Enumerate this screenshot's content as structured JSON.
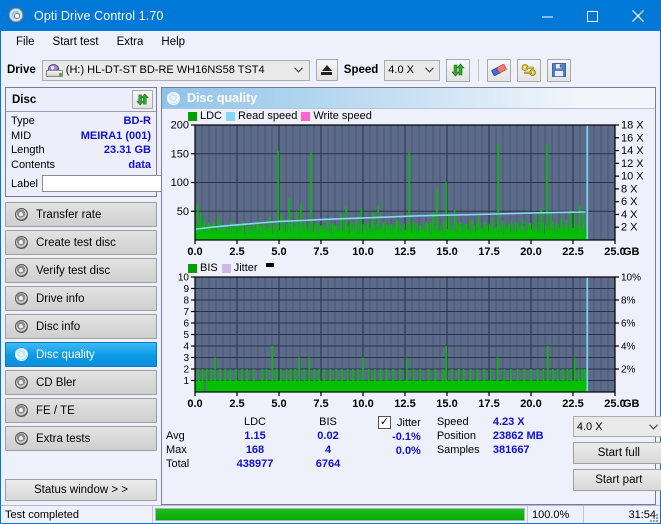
{
  "window": {
    "title": "Opti Drive Control 1.70",
    "icon": "cd-disc-icon",
    "minimize": "minimize-icon",
    "maximize": "maximize-icon",
    "close": "close-icon"
  },
  "menu": [
    {
      "label": "File"
    },
    {
      "label": "Start test"
    },
    {
      "label": "Extra"
    },
    {
      "label": "Help"
    }
  ],
  "toolbar": {
    "drive_label": "Drive",
    "drive_value": "(H:)   HL-DT-ST BD-RE  WH16NS58 TST4",
    "eject_icon": "eject-icon",
    "speed_label": "Speed",
    "speed_value": "4.0 X",
    "refresh_icon": "refresh-icon",
    "eraser_icon": "eraser-icon",
    "keys_icon": "keys-icon",
    "save_icon": "save-disk-icon"
  },
  "disc_panel": {
    "title": "Disc",
    "refresh_icon": "refresh-icon",
    "rows": [
      {
        "key": "Type",
        "value": "BD-R"
      },
      {
        "key": "MID",
        "value": "MEIRA1 (001)"
      },
      {
        "key": "Length",
        "value": "23.31 GB"
      },
      {
        "key": "Contents",
        "value": "data"
      }
    ],
    "label_key": "Label",
    "label_value": "",
    "label_placeholder": "",
    "disc_button_icon": "gold-disc-icon"
  },
  "sidebar": {
    "items": [
      {
        "label": "Transfer rate",
        "icon": "disc-icon",
        "active": false
      },
      {
        "label": "Create test disc",
        "icon": "disc-icon",
        "active": false
      },
      {
        "label": "Verify test disc",
        "icon": "disc-icon",
        "active": false
      },
      {
        "label": "Drive info",
        "icon": "disc-icon",
        "active": false
      },
      {
        "label": "Disc info",
        "icon": "disc-icon",
        "active": false
      },
      {
        "label": "Disc quality",
        "icon": "disc-icon",
        "active": true
      },
      {
        "label": "CD Bler",
        "icon": "disc-icon",
        "active": false
      },
      {
        "label": "FE / TE",
        "icon": "disc-icon",
        "active": false
      },
      {
        "label": "Extra tests",
        "icon": "disc-icon",
        "active": false
      }
    ],
    "status_window_button": "Status window > >"
  },
  "main": {
    "title": "Disc quality",
    "title_icon": "disc-icon"
  },
  "stats": {
    "col_headers": [
      "LDC",
      "BIS"
    ],
    "rows": [
      {
        "name": "Avg",
        "ldc": "1.15",
        "bis": "0.02",
        "jitter": "-0.1%"
      },
      {
        "name": "Max",
        "ldc": "168",
        "bis": "4",
        "jitter": "0.0%"
      },
      {
        "name": "Total",
        "ldc": "438977",
        "bis": "6764",
        "jitter": ""
      }
    ],
    "jitter_label": "Jitter",
    "jitter_checked": true,
    "speed_label": "Speed",
    "speed_value": "4.23 X",
    "position_label": "Position",
    "position_value": "23862 MB",
    "samples_label": "Samples",
    "samples_value": "381667",
    "speed_select_value": "4.0 X",
    "start_full_button": "Start full",
    "start_part_button": "Start part"
  },
  "statusbar": {
    "message": "Test completed",
    "progress_percent": 100.0,
    "progress_text": "100.0%",
    "elapsed": "31:54"
  },
  "chart_data": [
    {
      "id": "ldc-chart",
      "type": "area",
      "title": "",
      "xlabel": "GB",
      "ylabel": "LDC",
      "xlim": [
        0,
        25.0
      ],
      "ylim": [
        0,
        200
      ],
      "xticks": [
        "0.0",
        "2.5",
        "5.0",
        "7.5",
        "10.0",
        "12.5",
        "15.0",
        "17.5",
        "20.0",
        "22.5",
        "25.0"
      ],
      "yticks": [
        "50",
        "100",
        "150",
        "200"
      ],
      "y2label": "X",
      "y2lim": [
        0,
        18
      ],
      "y2ticks": [
        "2 X",
        "4 X",
        "6 X",
        "8 X",
        "10 X",
        "12 X",
        "14 X",
        "16 X",
        "18 X"
      ],
      "grid": true,
      "legend": [
        {
          "name": "LDC",
          "color": "#00a000"
        },
        {
          "name": "Read speed",
          "color": "#86d6f5"
        },
        {
          "name": "Write speed",
          "color": "#ff66cc"
        }
      ],
      "colors": {
        "plot_bg": "#5d6b8a",
        "grid": "#28324a",
        "axis": "#000000"
      },
      "series": [
        {
          "name": "LDC",
          "color": "#00c000",
          "x_end": 23.31,
          "baseline": [
            10,
            12,
            11,
            14,
            10,
            9,
            12,
            11,
            10,
            13,
            11,
            10,
            12,
            9,
            11,
            10,
            12,
            11,
            10,
            12,
            11,
            9,
            10,
            12,
            11,
            10,
            13,
            11,
            10,
            12,
            11,
            10,
            9,
            12,
            11,
            10,
            12,
            11,
            13,
            10,
            11,
            12,
            10,
            11,
            9,
            12,
            11,
            10,
            12,
            11,
            10,
            11,
            12,
            10,
            11,
            13,
            11,
            10,
            12,
            11,
            10,
            12,
            11,
            10,
            13,
            11,
            12,
            10,
            11,
            12,
            10,
            11,
            12,
            11,
            10,
            12,
            11,
            13,
            10,
            11,
            12,
            10,
            11,
            12,
            11,
            10,
            12,
            11,
            10,
            13,
            11,
            10,
            12,
            11,
            10,
            12,
            11,
            10,
            11,
            12
          ],
          "spikes": [
            {
              "x": 0.15,
              "y": 62
            },
            {
              "x": 0.35,
              "y": 48
            },
            {
              "x": 0.55,
              "y": 36
            },
            {
              "x": 0.8,
              "y": 30
            },
            {
              "x": 1.1,
              "y": 28
            },
            {
              "x": 1.45,
              "y": 42
            },
            {
              "x": 1.75,
              "y": 25
            },
            {
              "x": 2.1,
              "y": 22
            },
            {
              "x": 2.4,
              "y": 30
            },
            {
              "x": 2.85,
              "y": 26
            },
            {
              "x": 3.3,
              "y": 24
            },
            {
              "x": 3.7,
              "y": 33
            },
            {
              "x": 4.1,
              "y": 27
            },
            {
              "x": 4.45,
              "y": 40
            },
            {
              "x": 4.95,
              "y": 155
            },
            {
              "x": 5.15,
              "y": 45
            },
            {
              "x": 5.35,
              "y": 29
            },
            {
              "x": 5.6,
              "y": 72
            },
            {
              "x": 5.8,
              "y": 35
            },
            {
              "x": 6.05,
              "y": 50
            },
            {
              "x": 6.3,
              "y": 62
            },
            {
              "x": 6.6,
              "y": 30
            },
            {
              "x": 6.9,
              "y": 152
            },
            {
              "x": 7.15,
              "y": 28
            },
            {
              "x": 7.5,
              "y": 25
            },
            {
              "x": 7.9,
              "y": 33
            },
            {
              "x": 8.3,
              "y": 27
            },
            {
              "x": 8.7,
              "y": 46
            },
            {
              "x": 9.0,
              "y": 58
            },
            {
              "x": 9.3,
              "y": 31
            },
            {
              "x": 9.6,
              "y": 40
            },
            {
              "x": 9.9,
              "y": 55
            },
            {
              "x": 10.3,
              "y": 33
            },
            {
              "x": 10.6,
              "y": 48
            },
            {
              "x": 10.9,
              "y": 60
            },
            {
              "x": 11.2,
              "y": 30
            },
            {
              "x": 11.6,
              "y": 27
            },
            {
              "x": 12.0,
              "y": 35
            },
            {
              "x": 12.35,
              "y": 29
            },
            {
              "x": 12.75,
              "y": 152
            },
            {
              "x": 13.0,
              "y": 32
            },
            {
              "x": 13.4,
              "y": 26
            },
            {
              "x": 13.8,
              "y": 30
            },
            {
              "x": 14.15,
              "y": 48
            },
            {
              "x": 14.4,
              "y": 89
            },
            {
              "x": 14.95,
              "y": 100
            },
            {
              "x": 15.1,
              "y": 44
            },
            {
              "x": 15.45,
              "y": 52
            },
            {
              "x": 15.8,
              "y": 32
            },
            {
              "x": 16.1,
              "y": 28
            },
            {
              "x": 16.5,
              "y": 36
            },
            {
              "x": 16.9,
              "y": 45
            },
            {
              "x": 17.3,
              "y": 30
            },
            {
              "x": 17.7,
              "y": 40
            },
            {
              "x": 18.05,
              "y": 168
            },
            {
              "x": 18.3,
              "y": 34
            },
            {
              "x": 18.7,
              "y": 28
            },
            {
              "x": 19.1,
              "y": 32
            },
            {
              "x": 19.5,
              "y": 38
            },
            {
              "x": 19.9,
              "y": 30
            },
            {
              "x": 20.3,
              "y": 44
            },
            {
              "x": 20.6,
              "y": 55
            },
            {
              "x": 20.95,
              "y": 166
            },
            {
              "x": 21.2,
              "y": 47
            },
            {
              "x": 21.5,
              "y": 30
            },
            {
              "x": 21.8,
              "y": 40
            },
            {
              "x": 22.1,
              "y": 35
            },
            {
              "x": 22.35,
              "y": 52
            },
            {
              "x": 22.6,
              "y": 43
            },
            {
              "x": 22.9,
              "y": 60
            },
            {
              "x": 23.1,
              "y": 48
            }
          ]
        },
        {
          "name": "Read speed",
          "color": "#86d6f5",
          "points": [
            {
              "x": 0.05,
              "y": 1.7
            },
            {
              "x": 1.0,
              "y": 2.0
            },
            {
              "x": 2.2,
              "y": 2.3
            },
            {
              "x": 3.6,
              "y": 2.6
            },
            {
              "x": 5.0,
              "y": 2.9
            },
            {
              "x": 6.4,
              "y": 3.05
            },
            {
              "x": 7.5,
              "y": 3.2
            },
            {
              "x": 9.0,
              "y": 3.35
            },
            {
              "x": 10.5,
              "y": 3.5
            },
            {
              "x": 12.0,
              "y": 3.65
            },
            {
              "x": 13.3,
              "y": 3.78
            },
            {
              "x": 14.8,
              "y": 3.88
            },
            {
              "x": 16.3,
              "y": 3.95
            },
            {
              "x": 17.6,
              "y": 4.05
            },
            {
              "x": 19.0,
              "y": 4.15
            },
            {
              "x": 20.4,
              "y": 4.25
            },
            {
              "x": 21.8,
              "y": 4.32
            },
            {
              "x": 23.25,
              "y": 4.4
            }
          ]
        },
        {
          "name": "End marker",
          "color": "#7fd8f8",
          "vertical_line_x": 23.35
        }
      ]
    },
    {
      "id": "bis-chart",
      "type": "area",
      "title": "",
      "xlabel": "GB",
      "ylabel": "BIS",
      "xlim": [
        0,
        25.0
      ],
      "ylim": [
        0,
        10
      ],
      "xticks": [
        "0.0",
        "2.5",
        "5.0",
        "7.5",
        "10.0",
        "12.5",
        "15.0",
        "17.5",
        "20.0",
        "22.5",
        "25.0"
      ],
      "yticks": [
        "1",
        "2",
        "3",
        "4",
        "5",
        "6",
        "7",
        "8",
        "9",
        "10"
      ],
      "y2label": "%",
      "y2lim": [
        0,
        10
      ],
      "y2ticks": [
        "2%",
        "4%",
        "6%",
        "8%",
        "10%"
      ],
      "grid": true,
      "legend": [
        {
          "name": "BIS",
          "color": "#00a000"
        },
        {
          "name": "Jitter",
          "color": "#d0b8e8"
        }
      ],
      "colors": {
        "plot_bg": "#5d6b8a",
        "grid": "#28324a",
        "axis": "#000000"
      },
      "series": [
        {
          "name": "BIS",
          "color": "#00c000",
          "x_end": 23.31,
          "baseline_level": 1,
          "spikes": [
            {
              "x": 0.2,
              "y": 2
            },
            {
              "x": 0.45,
              "y": 2
            },
            {
              "x": 0.7,
              "y": 2
            },
            {
              "x": 0.95,
              "y": 2
            },
            {
              "x": 1.2,
              "y": 3
            },
            {
              "x": 1.5,
              "y": 2
            },
            {
              "x": 1.8,
              "y": 2
            },
            {
              "x": 2.1,
              "y": 2
            },
            {
              "x": 2.45,
              "y": 2
            },
            {
              "x": 2.8,
              "y": 2
            },
            {
              "x": 3.1,
              "y": 2
            },
            {
              "x": 3.5,
              "y": 2
            },
            {
              "x": 4.0,
              "y": 2
            },
            {
              "x": 4.25,
              "y": 2
            },
            {
              "x": 4.6,
              "y": 4
            },
            {
              "x": 4.85,
              "y": 2
            },
            {
              "x": 5.1,
              "y": 2
            },
            {
              "x": 5.45,
              "y": 2
            },
            {
              "x": 5.7,
              "y": 2
            },
            {
              "x": 5.95,
              "y": 2
            },
            {
              "x": 6.2,
              "y": 3
            },
            {
              "x": 6.5,
              "y": 2
            },
            {
              "x": 6.8,
              "y": 3
            },
            {
              "x": 7.1,
              "y": 2
            },
            {
              "x": 7.4,
              "y": 2
            },
            {
              "x": 7.7,
              "y": 2
            },
            {
              "x": 8.05,
              "y": 2
            },
            {
              "x": 8.4,
              "y": 2
            },
            {
              "x": 8.75,
              "y": 2
            },
            {
              "x": 9.1,
              "y": 2
            },
            {
              "x": 9.4,
              "y": 2
            },
            {
              "x": 9.7,
              "y": 2
            },
            {
              "x": 10.0,
              "y": 3
            },
            {
              "x": 10.35,
              "y": 2
            },
            {
              "x": 10.7,
              "y": 2
            },
            {
              "x": 11.05,
              "y": 2
            },
            {
              "x": 11.4,
              "y": 2
            },
            {
              "x": 11.8,
              "y": 2
            },
            {
              "x": 12.2,
              "y": 2
            },
            {
              "x": 12.6,
              "y": 3
            },
            {
              "x": 13.0,
              "y": 2
            },
            {
              "x": 13.4,
              "y": 2
            },
            {
              "x": 13.9,
              "y": 2
            },
            {
              "x": 14.3,
              "y": 2
            },
            {
              "x": 14.75,
              "y": 2
            },
            {
              "x": 14.95,
              "y": 4
            },
            {
              "x": 15.3,
              "y": 2
            },
            {
              "x": 15.7,
              "y": 2
            },
            {
              "x": 16.0,
              "y": 2
            },
            {
              "x": 16.4,
              "y": 2
            },
            {
              "x": 16.8,
              "y": 2
            },
            {
              "x": 17.2,
              "y": 2
            },
            {
              "x": 17.6,
              "y": 2
            },
            {
              "x": 18.0,
              "y": 3
            },
            {
              "x": 18.4,
              "y": 2
            },
            {
              "x": 18.8,
              "y": 2
            },
            {
              "x": 19.2,
              "y": 2
            },
            {
              "x": 19.6,
              "y": 2
            },
            {
              "x": 20.0,
              "y": 2
            },
            {
              "x": 20.4,
              "y": 2
            },
            {
              "x": 20.75,
              "y": 2
            },
            {
              "x": 21.0,
              "y": 4
            },
            {
              "x": 21.3,
              "y": 2
            },
            {
              "x": 21.6,
              "y": 2
            },
            {
              "x": 21.9,
              "y": 2
            },
            {
              "x": 22.15,
              "y": 2
            },
            {
              "x": 22.4,
              "y": 2
            },
            {
              "x": 22.6,
              "y": 3
            },
            {
              "x": 22.85,
              "y": 2
            },
            {
              "x": 23.05,
              "y": 2
            },
            {
              "x": 23.2,
              "y": 2
            }
          ]
        },
        {
          "name": "End marker",
          "color": "#7fd8f8",
          "vertical_line_x": 23.35
        }
      ]
    }
  ]
}
